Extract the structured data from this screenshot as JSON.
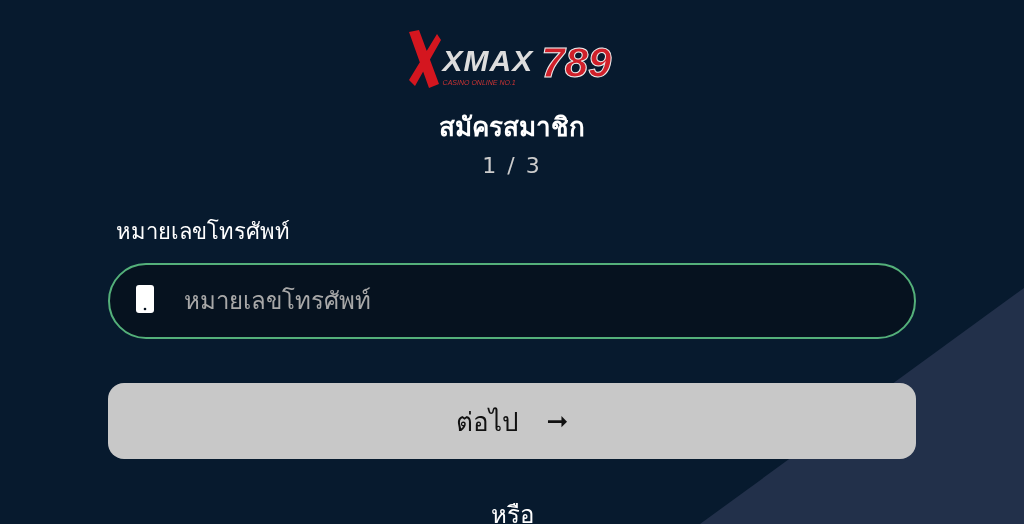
{
  "logo": {
    "brand": "XMAX",
    "number": "789",
    "tagline": "CASINO ONLINE NO.1"
  },
  "title": "สมัครสมาชิก",
  "step": "1 / 3",
  "phone_field": {
    "label": "หมายเลขโทรศัพท์",
    "placeholder": "หมายเลขโทรศัพท์"
  },
  "next_button": {
    "label": "ต่อไป",
    "arrow": "➞"
  },
  "divider_text": "หรือ"
}
